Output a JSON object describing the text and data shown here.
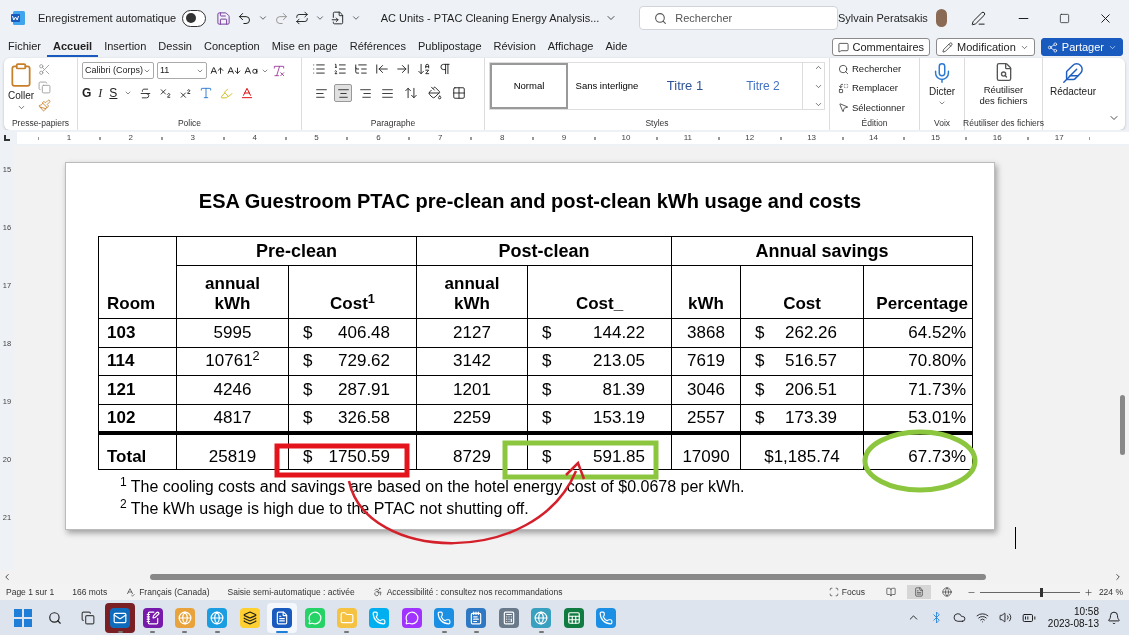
{
  "window": {
    "title": "AC Units - PTAC Cleaning Energy Analysis...",
    "autosave": {
      "label": "Enregistrement automatique",
      "on": false
    },
    "search": {
      "placeholder": "Rechercher"
    },
    "user": "Sylvain Peratsakis"
  },
  "menu": {
    "tabs": [
      {
        "label": "Fichier",
        "selected": false
      },
      {
        "label": "Accueil",
        "selected": true
      },
      {
        "label": "Insertion",
        "selected": false
      },
      {
        "label": "Dessin",
        "selected": false
      },
      {
        "label": "Conception",
        "selected": false
      },
      {
        "label": "Mise en page",
        "selected": false
      },
      {
        "label": "Références",
        "selected": false
      },
      {
        "label": "Publipostage",
        "selected": false
      },
      {
        "label": "Révision",
        "selected": false
      },
      {
        "label": "Affichage",
        "selected": false
      },
      {
        "label": "Aide",
        "selected": false
      }
    ],
    "actions": [
      {
        "kind": "comments",
        "label": "Commentaires"
      },
      {
        "kind": "mode",
        "label": "Modification"
      },
      {
        "kind": "share",
        "label": "Partager"
      }
    ]
  },
  "ribbon": {
    "clipboard": {
      "paste": "Coller",
      "group": "Presse-papiers"
    },
    "font": {
      "family": "Calibri (Corps)",
      "size": "11",
      "toggles": [
        {
          "kind": "bold",
          "label": "G"
        },
        {
          "kind": "italic",
          "label": "I"
        },
        {
          "kind": "underline",
          "label": "S"
        }
      ],
      "group": "Police"
    },
    "paragraph": {
      "alignment": [
        {
          "selected": false
        },
        {
          "selected": true
        },
        {
          "selected": false
        },
        {
          "selected": false
        }
      ],
      "group": "Paragraphe"
    },
    "styles": {
      "items": [
        {
          "kind": "normal",
          "label": "Normal",
          "selected": true
        },
        {
          "kind": "normal",
          "label": "Sans interligne",
          "selected": false
        },
        {
          "kind": "heading1",
          "label": "Titre 1",
          "selected": false
        },
        {
          "kind": "heading2",
          "label": "Titre 2",
          "selected": false
        }
      ],
      "group": "Styles"
    },
    "editing": {
      "items": [
        {
          "kind": "find",
          "label": "Rechercher"
        },
        {
          "kind": "replace",
          "label": "Remplacer"
        },
        {
          "kind": "select",
          "label": "Sélectionner"
        }
      ],
      "group": "Édition"
    },
    "voice": {
      "label": "Dicter",
      "group": "Voix"
    },
    "reuse": {
      "label": [
        "Réutiliser",
        "des fichiers"
      ],
      "group": "Réutiliser des fichiers"
    },
    "editor": {
      "label": "Rédacteur"
    }
  },
  "ruler": {
    "horizontal": [
      "1",
      "2",
      "3",
      "4",
      "5",
      "6",
      "7",
      "8",
      "9",
      "10",
      "11",
      "12",
      "13",
      "14",
      "15",
      "16",
      "17"
    ],
    "vertical": [
      "15",
      "16",
      "17",
      "18",
      "19",
      "20",
      "21"
    ]
  },
  "document": {
    "title": "ESA Guestroom PTAC pre-clean and post-clean kWh usage and costs",
    "table": {
      "first_column": "Room",
      "groups": [
        "Pre-clean",
        "Post-clean",
        "Annual savings"
      ],
      "columns": [
        "annual kWh",
        "Cost$^{1}$",
        "annual kWh",
        "Cost_",
        "kWh",
        "Cost",
        "Percentage"
      ],
      "rows": [
        {
          "room": "103",
          "pre_kwh": "5995",
          "pre_cost": {
            "sign": "$",
            "amount": "406.48"
          },
          "post_kwh": "2127",
          "post_cost": {
            "sign": "$",
            "amount": "144.22"
          },
          "save_kwh": "3868",
          "save_cost": {
            "sign": "$",
            "amount": "262.26"
          },
          "percentage": "64.52%"
        },
        {
          "room": "114",
          "pre_kwh": "10761$^{2}$",
          "pre_cost": {
            "sign": "$",
            "amount": "729.62"
          },
          "post_kwh": "3142",
          "post_cost": {
            "sign": "$",
            "amount": "213.05"
          },
          "save_kwh": "7619",
          "save_cost": {
            "sign": "$",
            "amount": "516.57"
          },
          "percentage": "70.80%"
        },
        {
          "room": "121",
          "pre_kwh": "4246",
          "pre_cost": {
            "sign": "$",
            "amount": "287.91"
          },
          "post_kwh": "1201",
          "post_cost": {
            "sign": "$",
            "amount": "81.39"
          },
          "save_kwh": "3046",
          "save_cost": {
            "sign": "$",
            "amount": "206.51"
          },
          "percentage": "71.73%"
        },
        {
          "room": "102",
          "pre_kwh": "4817",
          "pre_cost": {
            "sign": "$",
            "amount": "326.58"
          },
          "post_kwh": "2259",
          "post_cost": {
            "sign": "$",
            "amount": "153.19"
          },
          "save_kwh": "2557",
          "save_cost": {
            "sign": "$",
            "amount": "173.39"
          },
          "percentage": "53.01%"
        }
      ],
      "total": {
        "room": "Total",
        "pre_kwh": "25819",
        "pre_cost": {
          "sign": "$",
          "amount": "1750.59"
        },
        "post_kwh": "8729",
        "post_cost": {
          "sign": "$",
          "amount": "591.85"
        },
        "save_kwh": "17090",
        "save_cost": {
          "amount": "$1,185.74"
        },
        "percentage": "67.73%"
      }
    },
    "footnotes": [
      "$^{1}$ The cooling costs and savings are based on the hotel energy cost of $0.0678 per kWh.",
      "$^{2}$ The kWh usage is high due to the PTAC not shutting off."
    ]
  },
  "status_bar": {
    "items": [
      {
        "kind": "text",
        "label": "Page 1 sur 1"
      },
      {
        "kind": "text",
        "label": "166 mots"
      },
      {
        "kind": "language",
        "label": "Français (Canada)"
      },
      {
        "kind": "text",
        "label": "Saisie semi-automatique : activée"
      },
      {
        "kind": "accessibility",
        "label": "Accessibilité : consultez nos recommandations"
      }
    ],
    "focus": "Focus",
    "views": [
      {
        "kind": "read",
        "selected": false
      },
      {
        "kind": "print",
        "selected": true
      },
      {
        "kind": "web",
        "selected": false
      }
    ],
    "zoom": {
      "level": 0.6,
      "reading": "224 %"
    }
  },
  "taskbar": {
    "apps": [
      {
        "kind": "start",
        "active": false,
        "alert": false,
        "running": false
      },
      {
        "kind": "search",
        "active": false,
        "alert": false,
        "running": false
      },
      {
        "kind": "taskview",
        "active": false,
        "alert": false,
        "running": false
      },
      {
        "kind": "mail",
        "active": false,
        "alert": true,
        "running": true
      },
      {
        "kind": "notes",
        "active": false,
        "alert": false,
        "running": true
      },
      {
        "kind": "browser",
        "active": false,
        "alert": false,
        "running": true
      },
      {
        "kind": "web",
        "active": false,
        "alert": false,
        "running": true
      },
      {
        "kind": "board",
        "active": false,
        "alert": false,
        "running": false
      },
      {
        "kind": "word",
        "active": true,
        "alert": false,
        "running": true
      },
      {
        "kind": "chat",
        "active": false,
        "alert": false,
        "running": false
      },
      {
        "kind": "folder",
        "active": false,
        "alert": false,
        "running": true
      },
      {
        "kind": "call",
        "active": false,
        "alert": false,
        "running": false
      },
      {
        "kind": "messenger",
        "active": false,
        "alert": false,
        "running": false
      },
      {
        "kind": "phone",
        "active": false,
        "alert": false,
        "running": true
      },
      {
        "kind": "notepad",
        "active": false,
        "alert": false,
        "running": true
      },
      {
        "kind": "calculator",
        "active": false,
        "alert": false,
        "running": false
      },
      {
        "kind": "globe",
        "active": false,
        "alert": false,
        "running": true
      },
      {
        "kind": "sheet",
        "active": false,
        "alert": false,
        "running": false
      },
      {
        "kind": "phone",
        "active": false,
        "alert": false,
        "running": false
      }
    ],
    "clock": {
      "time": "10:58",
      "date": "2023-08-13"
    }
  }
}
